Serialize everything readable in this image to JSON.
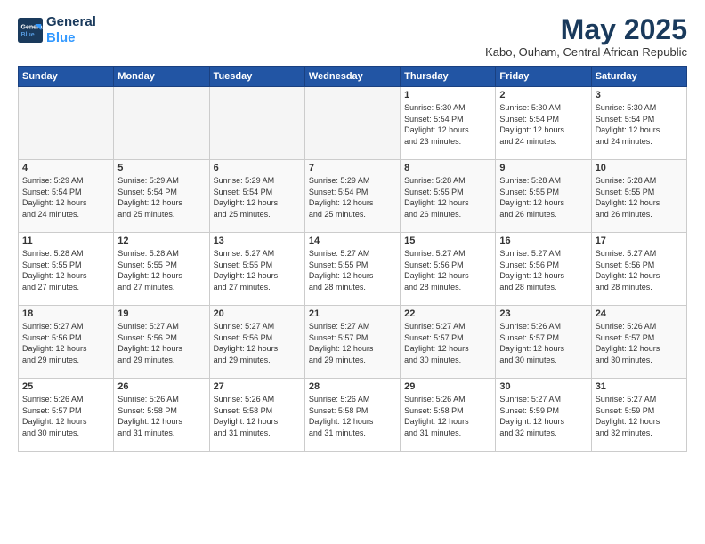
{
  "logo": {
    "line1": "General",
    "line2": "Blue"
  },
  "title": "May 2025",
  "location": "Kabo, Ouham, Central African Republic",
  "days_header": [
    "Sunday",
    "Monday",
    "Tuesday",
    "Wednesday",
    "Thursday",
    "Friday",
    "Saturday"
  ],
  "weeks": [
    [
      {
        "day": "",
        "text": ""
      },
      {
        "day": "",
        "text": ""
      },
      {
        "day": "",
        "text": ""
      },
      {
        "day": "",
        "text": ""
      },
      {
        "day": "1",
        "text": "Sunrise: 5:30 AM\nSunset: 5:54 PM\nDaylight: 12 hours\nand 23 minutes."
      },
      {
        "day": "2",
        "text": "Sunrise: 5:30 AM\nSunset: 5:54 PM\nDaylight: 12 hours\nand 24 minutes."
      },
      {
        "day": "3",
        "text": "Sunrise: 5:30 AM\nSunset: 5:54 PM\nDaylight: 12 hours\nand 24 minutes."
      }
    ],
    [
      {
        "day": "4",
        "text": "Sunrise: 5:29 AM\nSunset: 5:54 PM\nDaylight: 12 hours\nand 24 minutes."
      },
      {
        "day": "5",
        "text": "Sunrise: 5:29 AM\nSunset: 5:54 PM\nDaylight: 12 hours\nand 25 minutes."
      },
      {
        "day": "6",
        "text": "Sunrise: 5:29 AM\nSunset: 5:54 PM\nDaylight: 12 hours\nand 25 minutes."
      },
      {
        "day": "7",
        "text": "Sunrise: 5:29 AM\nSunset: 5:54 PM\nDaylight: 12 hours\nand 25 minutes."
      },
      {
        "day": "8",
        "text": "Sunrise: 5:28 AM\nSunset: 5:55 PM\nDaylight: 12 hours\nand 26 minutes."
      },
      {
        "day": "9",
        "text": "Sunrise: 5:28 AM\nSunset: 5:55 PM\nDaylight: 12 hours\nand 26 minutes."
      },
      {
        "day": "10",
        "text": "Sunrise: 5:28 AM\nSunset: 5:55 PM\nDaylight: 12 hours\nand 26 minutes."
      }
    ],
    [
      {
        "day": "11",
        "text": "Sunrise: 5:28 AM\nSunset: 5:55 PM\nDaylight: 12 hours\nand 27 minutes."
      },
      {
        "day": "12",
        "text": "Sunrise: 5:28 AM\nSunset: 5:55 PM\nDaylight: 12 hours\nand 27 minutes."
      },
      {
        "day": "13",
        "text": "Sunrise: 5:27 AM\nSunset: 5:55 PM\nDaylight: 12 hours\nand 27 minutes."
      },
      {
        "day": "14",
        "text": "Sunrise: 5:27 AM\nSunset: 5:55 PM\nDaylight: 12 hours\nand 28 minutes."
      },
      {
        "day": "15",
        "text": "Sunrise: 5:27 AM\nSunset: 5:56 PM\nDaylight: 12 hours\nand 28 minutes."
      },
      {
        "day": "16",
        "text": "Sunrise: 5:27 AM\nSunset: 5:56 PM\nDaylight: 12 hours\nand 28 minutes."
      },
      {
        "day": "17",
        "text": "Sunrise: 5:27 AM\nSunset: 5:56 PM\nDaylight: 12 hours\nand 28 minutes."
      }
    ],
    [
      {
        "day": "18",
        "text": "Sunrise: 5:27 AM\nSunset: 5:56 PM\nDaylight: 12 hours\nand 29 minutes."
      },
      {
        "day": "19",
        "text": "Sunrise: 5:27 AM\nSunset: 5:56 PM\nDaylight: 12 hours\nand 29 minutes."
      },
      {
        "day": "20",
        "text": "Sunrise: 5:27 AM\nSunset: 5:56 PM\nDaylight: 12 hours\nand 29 minutes."
      },
      {
        "day": "21",
        "text": "Sunrise: 5:27 AM\nSunset: 5:57 PM\nDaylight: 12 hours\nand 29 minutes."
      },
      {
        "day": "22",
        "text": "Sunrise: 5:27 AM\nSunset: 5:57 PM\nDaylight: 12 hours\nand 30 minutes."
      },
      {
        "day": "23",
        "text": "Sunrise: 5:26 AM\nSunset: 5:57 PM\nDaylight: 12 hours\nand 30 minutes."
      },
      {
        "day": "24",
        "text": "Sunrise: 5:26 AM\nSunset: 5:57 PM\nDaylight: 12 hours\nand 30 minutes."
      }
    ],
    [
      {
        "day": "25",
        "text": "Sunrise: 5:26 AM\nSunset: 5:57 PM\nDaylight: 12 hours\nand 30 minutes."
      },
      {
        "day": "26",
        "text": "Sunrise: 5:26 AM\nSunset: 5:58 PM\nDaylight: 12 hours\nand 31 minutes."
      },
      {
        "day": "27",
        "text": "Sunrise: 5:26 AM\nSunset: 5:58 PM\nDaylight: 12 hours\nand 31 minutes."
      },
      {
        "day": "28",
        "text": "Sunrise: 5:26 AM\nSunset: 5:58 PM\nDaylight: 12 hours\nand 31 minutes."
      },
      {
        "day": "29",
        "text": "Sunrise: 5:26 AM\nSunset: 5:58 PM\nDaylight: 12 hours\nand 31 minutes."
      },
      {
        "day": "30",
        "text": "Sunrise: 5:27 AM\nSunset: 5:59 PM\nDaylight: 12 hours\nand 32 minutes."
      },
      {
        "day": "31",
        "text": "Sunrise: 5:27 AM\nSunset: 5:59 PM\nDaylight: 12 hours\nand 32 minutes."
      }
    ]
  ]
}
